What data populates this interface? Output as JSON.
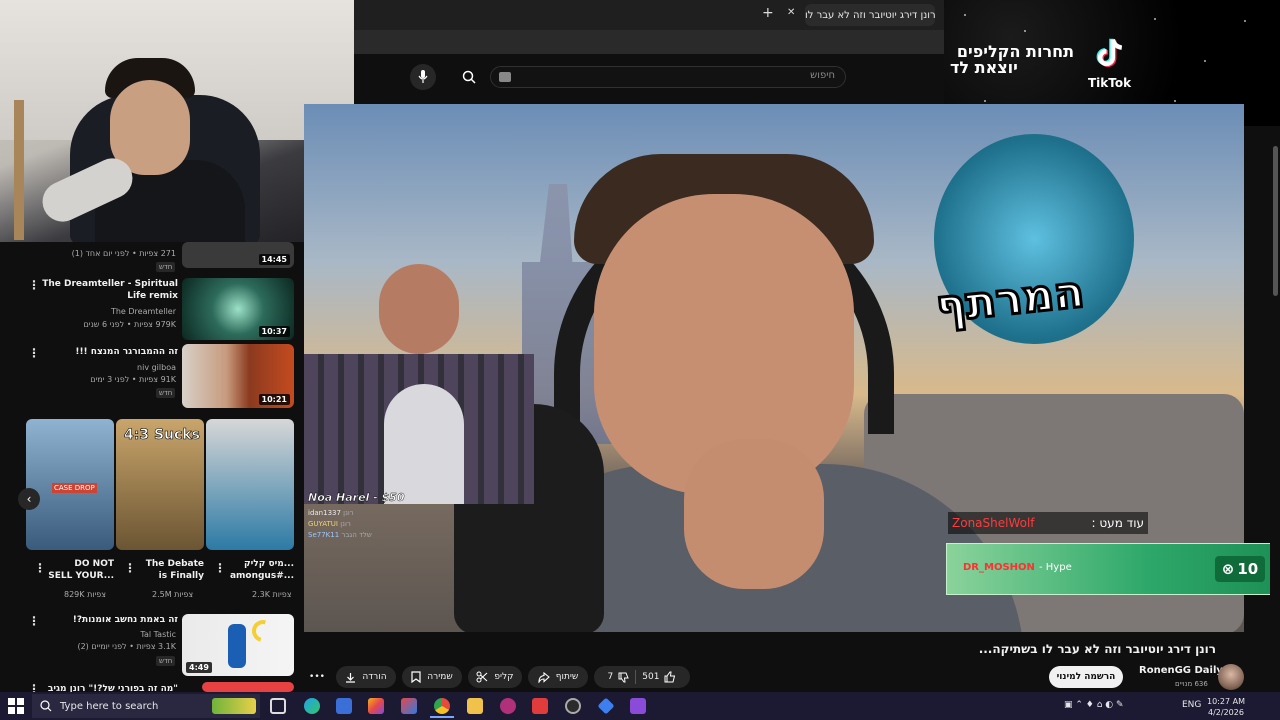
{
  "browser": {
    "tab_title": "(379) רונן דירג יוטיובר וזה לא עבר לו",
    "new_tab": "+",
    "close": "✕"
  },
  "search": {
    "placeholder": "חיפוש"
  },
  "tiktok": {
    "line1": "תחרות הקליפים",
    "line2": "יוצאת לד",
    "brand": "TikTok"
  },
  "overlay": {
    "pip_label": "Noa Harel - $50",
    "chat_users": [
      "idan1337",
      "GUYATUI",
      "Se77K11"
    ],
    "chat_texts": [
      "רונן",
      "רונן",
      "שלד הגבר"
    ],
    "message_name": "ZonaShelWolf",
    "message_text": "עוד מעט :",
    "hype_user": "DR_MOSHON",
    "hype_label": "- Hype",
    "hype_count": "10"
  },
  "sidebar": {
    "items": [
      {
        "title": "",
        "meta": "271 צפיות • לפני יום אחד (1)",
        "new": "חדש",
        "duration": "14:45"
      },
      {
        "title": "The Dreamteller - Spiritual Life remix",
        "channel": "The Dreamteller",
        "meta": "979K צפיות • לפני 6 שנים",
        "duration": "10:37"
      },
      {
        "title": "זה ההמבורגר המנצח !!!",
        "channel": "niv gilboa",
        "meta": "91K צפיות • לפני 3 ימים",
        "new": "חדש",
        "duration": "10:21"
      },
      {
        "title": "זה באמת נחשב אומנות?!",
        "channel": "Tal Tastic",
        "meta": "3.1K צפיות • לפני יומיים (2)",
        "new": "חדש",
        "duration": "4:49"
      },
      {
        "title": "\"מה זה בפורני של?!\" רונן מגיב"
      }
    ],
    "shorts": [
      {
        "title": "DO NOT SELL YOUR...",
        "views": "829K צפיות",
        "badge": "CASE DROP"
      },
      {
        "title": "The Debate is Finally",
        "views": "2.5M צפיות",
        "badge": "4:3 Sucks"
      },
      {
        "title": "מיס קליק... amongus#...",
        "views": "2.3K צפיות",
        "badge": ""
      }
    ]
  },
  "video": {
    "title": "רונן דירג יוטיובר וזה לא עבר לו בשתיקה...",
    "logo_text": "המרתף",
    "channel": "RonenGG Daily",
    "subscribers": "636 מנויים",
    "subscribe": "הרשמה למינוי",
    "likes": "501",
    "dislikes": "7",
    "share": "שיתוף",
    "clip": "קליפ",
    "save": "שמירה",
    "download": "הורדה",
    "more": "•••"
  },
  "taskbar": {
    "search": "Type here to search",
    "lang": "ENG",
    "time": "10:27 AM",
    "date": "4/2/2026"
  },
  "colors": {
    "youtube_red": "#ff0033",
    "hype_green": "#2ea86a",
    "taskbar": "#1c1a33"
  }
}
